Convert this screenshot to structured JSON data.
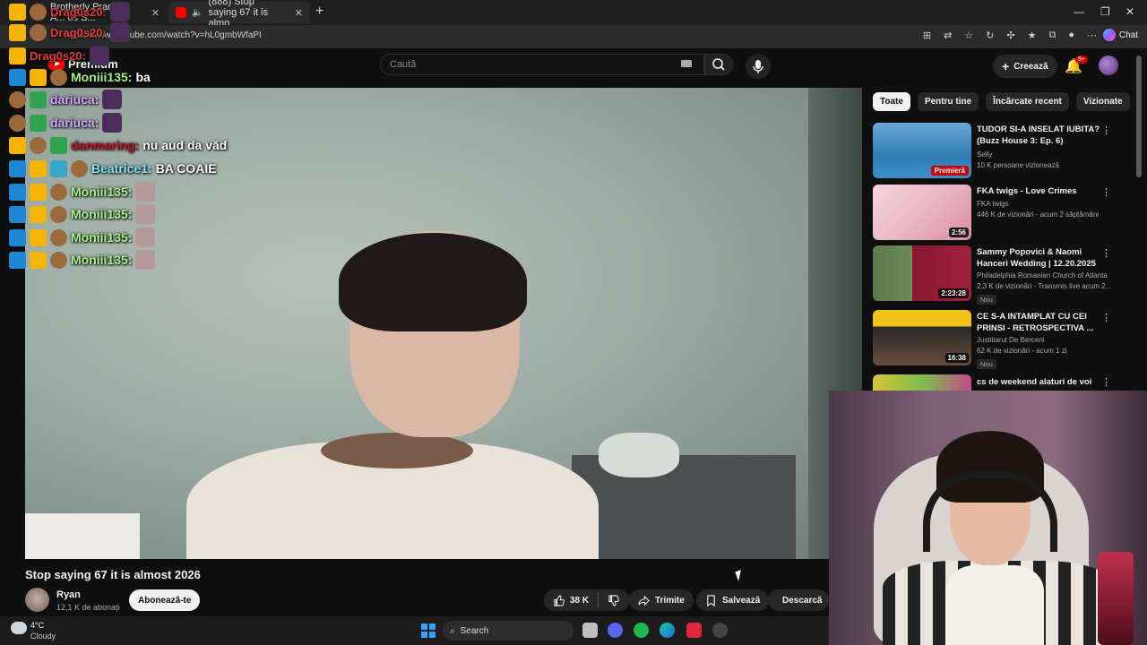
{
  "browser": {
    "tabs": [
      {
        "label": "Brotherly Pranks: A... us S..."
      },
      {
        "label": "(888) Stop saying 67 it is almo"
      }
    ],
    "url": "https://www.youtube.com/watch?v=hL0gmbWfaPI",
    "chat_button": "Chat"
  },
  "youtube": {
    "logo_text": "Premium",
    "search_placeholder": "Caută",
    "create_label": "Creează",
    "notifications_badge": "9+"
  },
  "chat": {
    "messages": [
      {
        "user": "Drag0s20:",
        "text": "",
        "color": "#e23b3b"
      },
      {
        "user": "Drag0s20:",
        "text": "",
        "color": "#e23b3b"
      },
      {
        "user": "Drag0s20:",
        "text": "",
        "color": "#e23b3b"
      },
      {
        "user": "Moniii135:",
        "text": "ba",
        "color": "#a7f08a"
      },
      {
        "user": "dariuca:",
        "text": "",
        "color": "#d7a7ff"
      },
      {
        "user": "dariuca:",
        "text": "",
        "color": "#d7a7ff"
      },
      {
        "user": "danmaring:",
        "text": "nu aud da văd",
        "color": "#c0182a"
      },
      {
        "user": "Beatrice1:",
        "text": "BA COAIE",
        "color": "#7fe6ff"
      },
      {
        "user": "Moniii135:",
        "text": "",
        "color": "#a7f08a"
      },
      {
        "user": "Moniii135:",
        "text": "",
        "color": "#a7f08a"
      },
      {
        "user": "Moniii135:",
        "text": "",
        "color": "#a7f08a"
      },
      {
        "user": "Moniii135:",
        "text": "",
        "color": "#a7f08a"
      }
    ]
  },
  "video": {
    "title": "Stop saying 67 it is almost 2026",
    "channel": "Ryan",
    "subscribers": "12,1 K de abonați",
    "subscribe_label": "Abonează-te",
    "likes": "38 K",
    "share_label": "Trimite",
    "save_label": "Salvează",
    "download_label": "Descarcă"
  },
  "sidebar": {
    "chips": [
      "Toate",
      "Pentru tine",
      "Încărcate recent",
      "Vizionate"
    ],
    "recommendations": [
      {
        "title": "TUDOR SI-A INSELAT IUBITA? (Buzz House 3: Ep. 6)",
        "channel": "Selly",
        "meta": "10 K persoane vizionează",
        "badge": "Premieră",
        "new": ""
      },
      {
        "title": "FKA twigs - Love Crimes",
        "channel": "FKA twigs",
        "meta": "446 K de vizionări - acum 2 săptămâni",
        "badge": "2:56",
        "new": ""
      },
      {
        "title": "Sammy Popovici & Naomi Hanceri Wedding | 12.20.2025",
        "channel": "Philadelphia Romanian Church of Atlanta",
        "meta": "2,3 K de vizionări - Transmis live acum 2...",
        "badge": "2:23:28",
        "new": "Nou"
      },
      {
        "title": "CE S-A INTAMPLAT CU CEI PRINSI - RETROSPECTIVA ...",
        "channel": "Justitiarul De Berceni",
        "meta": "62 K de vizionări - acum 1 zi",
        "badge": "16:38",
        "new": "Nou"
      },
      {
        "title": "cs de weekend alaturi de voi",
        "channel": "",
        "meta": "",
        "badge": "",
        "new": ""
      }
    ]
  },
  "taskbar": {
    "temperature": "4°C",
    "weather": "Cloudy",
    "search_label": "Search"
  }
}
